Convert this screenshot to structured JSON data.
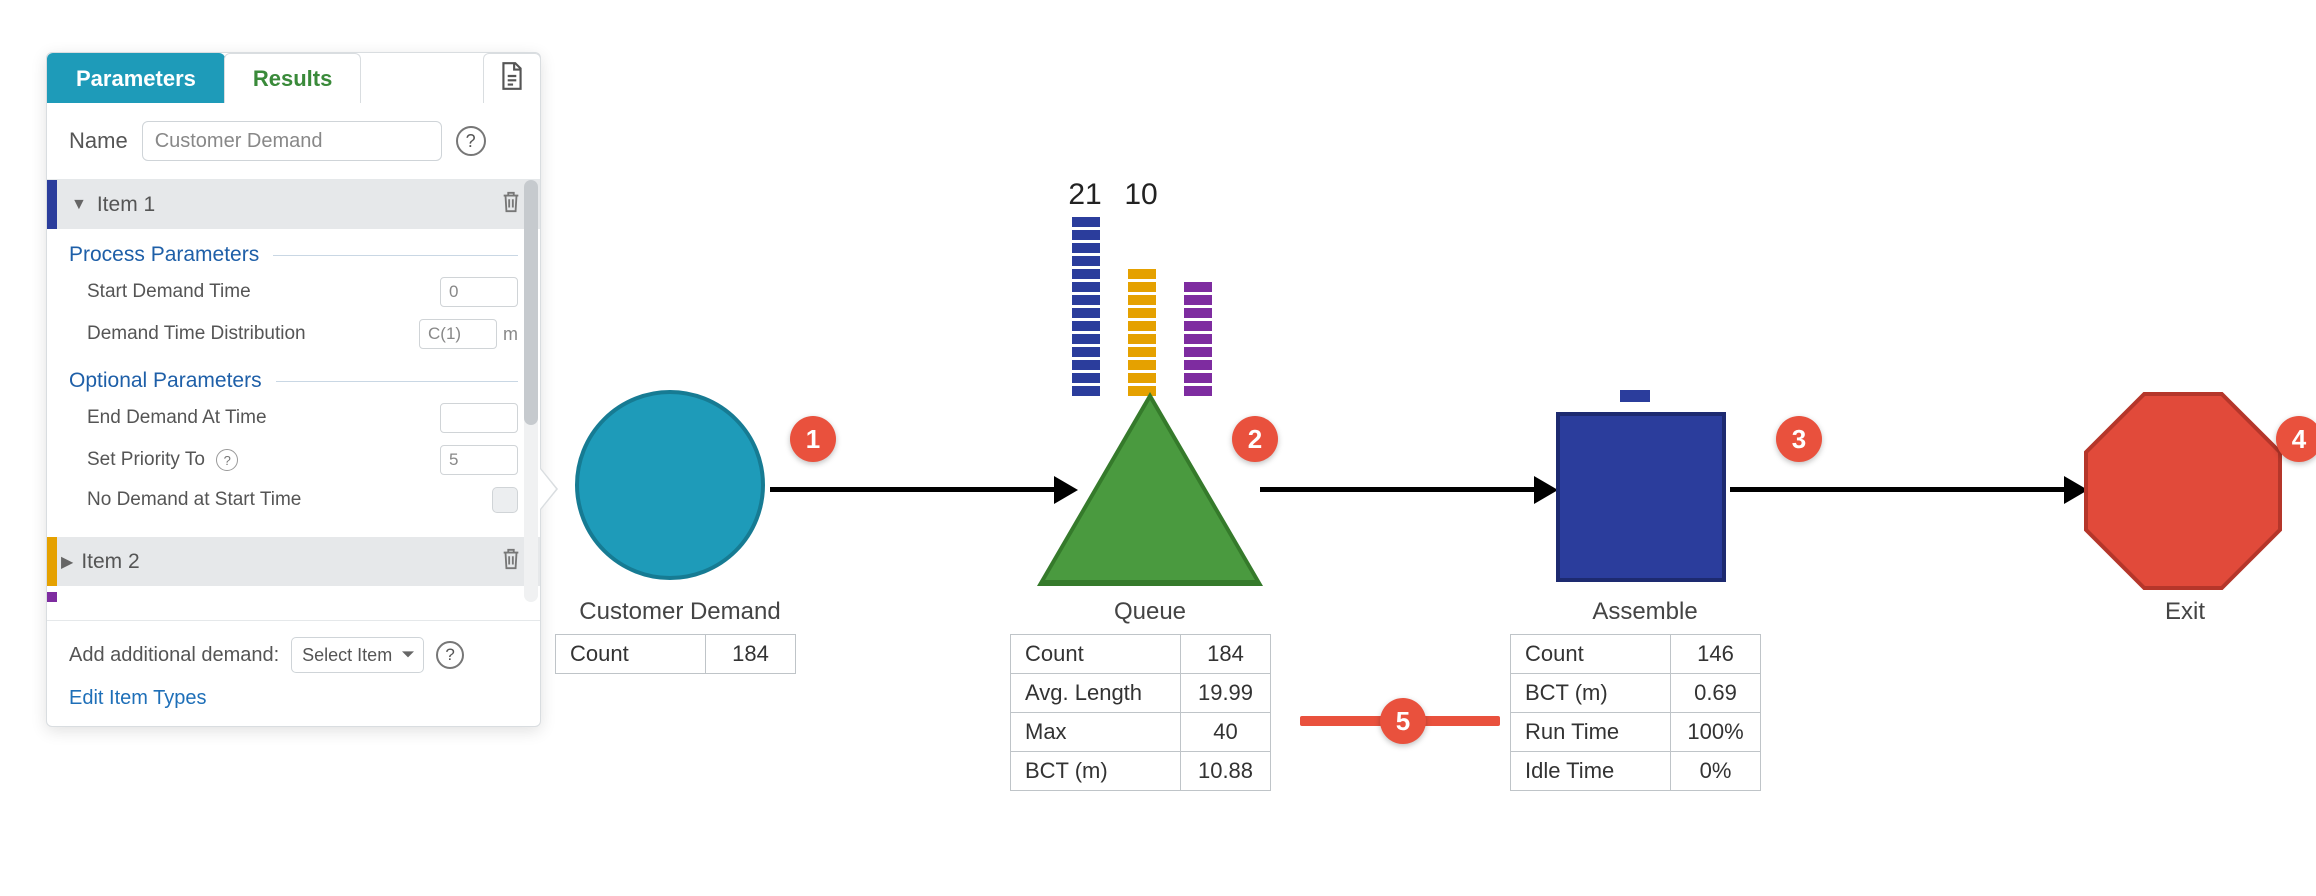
{
  "tabs": {
    "parameters": "Parameters",
    "results": "Results"
  },
  "panel": {
    "name_label": "Name",
    "name_value": "Customer Demand",
    "item1": {
      "title": "Item 1"
    },
    "process_heading": "Process Parameters",
    "start_demand_label": "Start Demand Time",
    "start_demand_value": "0",
    "dist_label": "Demand Time Distribution",
    "dist_value": "C(1)",
    "dist_unit": "m",
    "optional_heading": "Optional Parameters",
    "end_demand_label": "End Demand At Time",
    "end_demand_value": "",
    "priority_label": "Set Priority To",
    "priority_value": "5",
    "no_demand_label": "No Demand at Start Time",
    "item2": {
      "title": "Item 2"
    },
    "add_label": "Add additional demand:",
    "select_label": "Select Item",
    "edit_types": "Edit Item Types"
  },
  "nodes": {
    "demand": {
      "label": "Customer Demand",
      "stats": [
        [
          "Count",
          "184"
        ]
      ]
    },
    "queue": {
      "label": "Queue",
      "stacks": {
        "blue": 21,
        "orange": 10,
        "purple": 9
      },
      "stack_labels": {
        "blue": "21",
        "orange": "10"
      },
      "stats": [
        [
          "Count",
          "184"
        ],
        [
          "Avg. Length",
          "19.99"
        ],
        [
          "Max",
          "40"
        ],
        [
          "BCT (m)",
          "10.88"
        ]
      ]
    },
    "assemble": {
      "label": "Assemble",
      "stats": [
        [
          "Count",
          "146"
        ],
        [
          "BCT (m)",
          "0.69"
        ],
        [
          "Run Time",
          "100%"
        ],
        [
          "Idle Time",
          "0%"
        ]
      ]
    },
    "exit": {
      "label": "Exit"
    }
  },
  "badges": {
    "b1": "1",
    "b2": "2",
    "b3": "3",
    "b4": "4",
    "b5": "5"
  }
}
